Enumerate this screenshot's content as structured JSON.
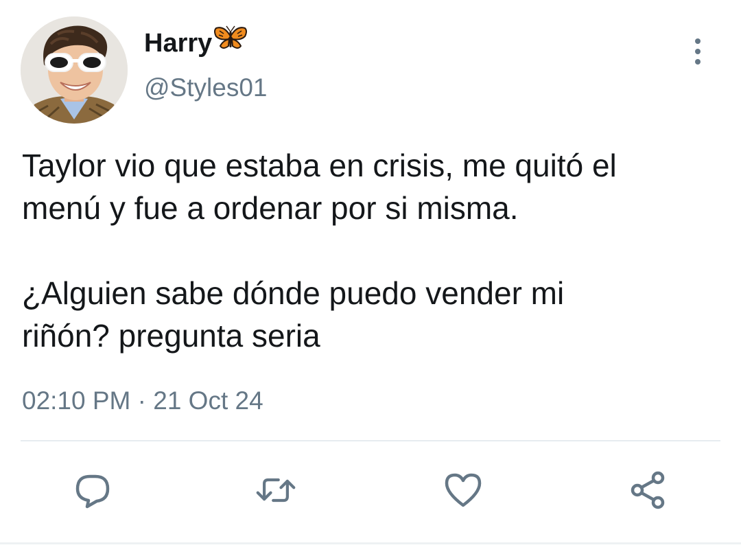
{
  "tweet": {
    "author": {
      "display_name": "Harry",
      "name_emoji": "butterfly-icon",
      "handle": "@Styles01"
    },
    "text": [
      "Taylor vio que estaba en crisis, me quitó el\nmenú y fue a ordenar por si misma.",
      "¿Alguien sabe dónde puedo vender mi\nriñón? pregunta seria"
    ],
    "timestamp": "02:10 PM · 21 Oct 24"
  },
  "actions": {
    "reply_icon": "reply-icon",
    "retweet_icon": "retweet-icon",
    "like_icon": "heart-icon",
    "share_icon": "share-icon",
    "more_icon": "more-vertical-icon"
  },
  "colors": {
    "text": "#14171a",
    "secondary": "#657786",
    "divider": "#e6ecf0",
    "butterfly_orange": "#f08b1e"
  }
}
